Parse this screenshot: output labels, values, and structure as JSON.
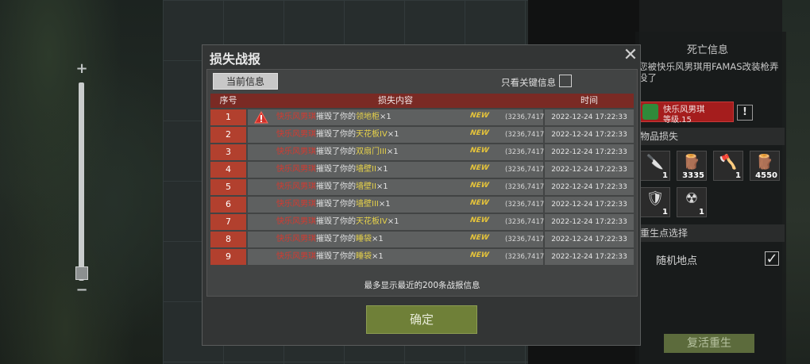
{
  "dialog": {
    "title": "损失战报",
    "tab_current": "当前信息",
    "filter_label": "只看关键信息",
    "headers": {
      "index": "序号",
      "content": "损失内容",
      "time": "时间"
    },
    "footnote": "最多显示最近的200条战报信息",
    "confirm": "确定",
    "rows": [
      {
        "index": "1",
        "attacker": "快乐风男琪",
        "action": "摧毁了你的",
        "item": "领地柜",
        "qty": "×1",
        "badge": "NEW",
        "coords": "(3236,7417)",
        "time": "2022-12-24 17:22:33",
        "warning": true
      },
      {
        "index": "2",
        "attacker": "快乐风男琪",
        "action": "摧毁了你的",
        "item": "天花板IV",
        "qty": "×1",
        "badge": "NEW",
        "coords": "(3236,7417)",
        "time": "2022-12-24 17:22:33",
        "warning": false
      },
      {
        "index": "3",
        "attacker": "快乐风男琪",
        "action": "摧毁了你的",
        "item": "双扇门III",
        "qty": "×1",
        "badge": "NEW",
        "coords": "(3236,7417)",
        "time": "2022-12-24 17:22:33",
        "warning": false
      },
      {
        "index": "4",
        "attacker": "快乐风男琪",
        "action": "摧毁了你的",
        "item": "墙壁II",
        "qty": "×1",
        "badge": "NEW",
        "coords": "(3236,7417)",
        "time": "2022-12-24 17:22:33",
        "warning": false
      },
      {
        "index": "5",
        "attacker": "快乐风男琪",
        "action": "摧毁了你的",
        "item": "墙壁II",
        "qty": "×1",
        "badge": "NEW",
        "coords": "(3236,7417)",
        "time": "2022-12-24 17:22:33",
        "warning": false
      },
      {
        "index": "6",
        "attacker": "快乐风男琪",
        "action": "摧毁了你的",
        "item": "墙壁III",
        "qty": "×1",
        "badge": "NEW",
        "coords": "(3236,7417)",
        "time": "2022-12-24 17:22:33",
        "warning": false
      },
      {
        "index": "7",
        "attacker": "快乐风男琪",
        "action": "摧毁了你的",
        "item": "天花板IV",
        "qty": "×1",
        "badge": "NEW",
        "coords": "(3236,7417)",
        "time": "2022-12-24 17:22:33",
        "warning": false
      },
      {
        "index": "8",
        "attacker": "快乐风男琪",
        "action": "摧毁了你的",
        "item": "睡袋",
        "qty": "×1",
        "badge": "NEW",
        "coords": "(3236,7417)",
        "time": "2022-12-24 17:22:33",
        "warning": false
      },
      {
        "index": "9",
        "attacker": "快乐风男琪",
        "action": "摧毁了你的",
        "item": "睡袋",
        "qty": "×1",
        "badge": "NEW",
        "coords": "(3236,7417)",
        "time": "2022-12-24 17:22:33",
        "warning": false
      }
    ]
  },
  "side_panel": {
    "title": "死亡信息",
    "death_message": "您被快乐风男琪用FAMAS改装枪弄没了",
    "killer_name": "快乐风男琪",
    "killer_level": "等级.15",
    "report_icon": "!",
    "items_section": "物品损失",
    "items": [
      {
        "icon": "knife-icon",
        "glyph": "🔪",
        "qty": "1"
      },
      {
        "icon": "wood-logs-icon",
        "glyph": "🪵",
        "qty": "3335"
      },
      {
        "icon": "axe-icon",
        "glyph": "🪓",
        "qty": "1"
      },
      {
        "icon": "wood-logs-icon",
        "glyph": "🪵",
        "qty": "4550"
      },
      {
        "icon": "armor-icon",
        "glyph": "🛡",
        "qty": "1"
      },
      {
        "icon": "gas-mask-icon",
        "glyph": "☢",
        "qty": "1"
      }
    ],
    "respawn_section": "重生点选择",
    "random_location": "随机地点",
    "revive_button": "复活重生"
  },
  "zoom": {
    "plus": "+",
    "minus": "−",
    "level": 0.07
  },
  "colors": {
    "header_red": "#7a2a24",
    "index_red": "#b2402e",
    "attacker_red": "#d43a30",
    "item_yellow": "#e7d24a",
    "confirm_green": "#6f8038"
  }
}
